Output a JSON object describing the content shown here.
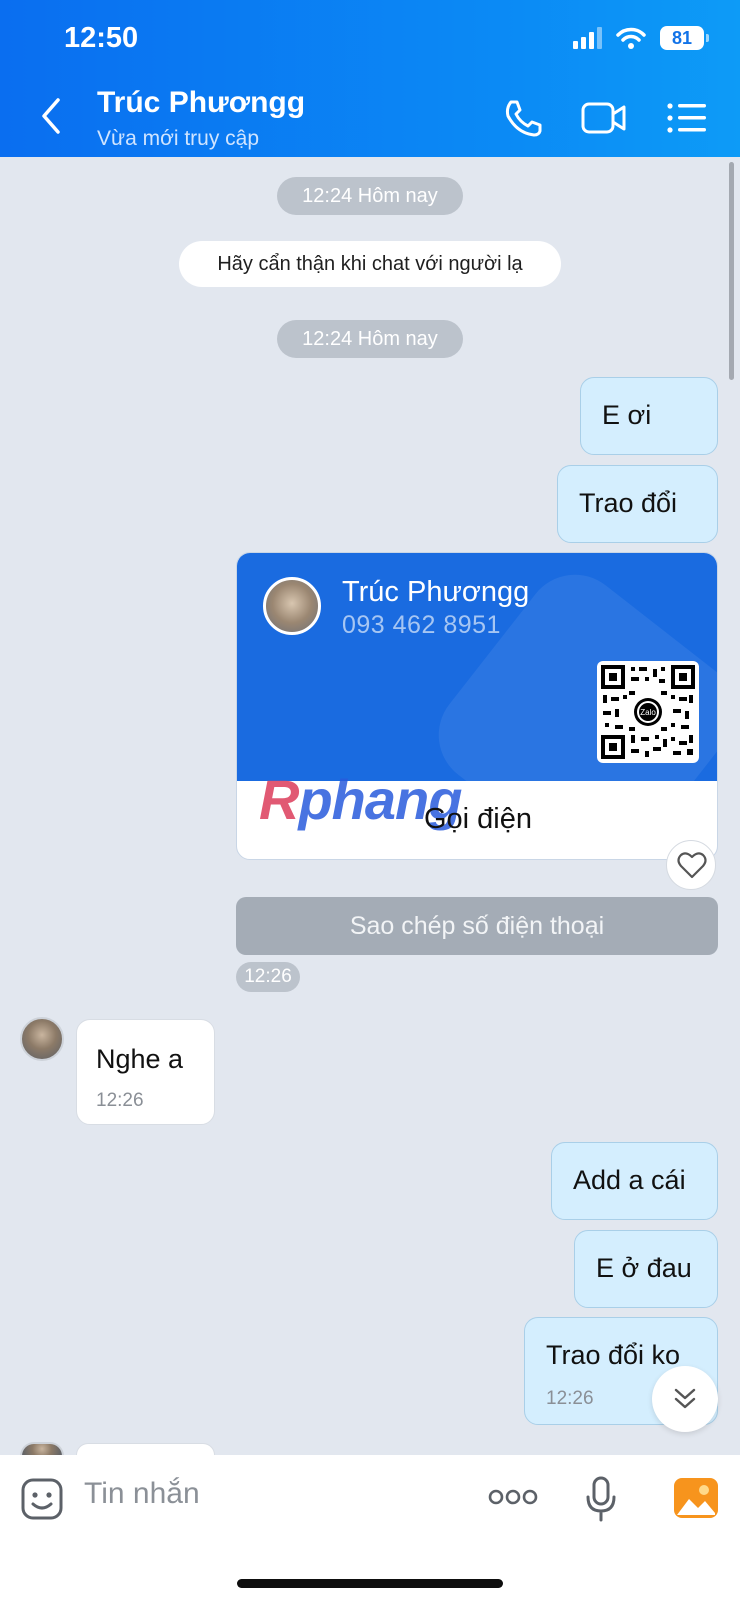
{
  "status_bar": {
    "time": "12:50",
    "battery": "81"
  },
  "header": {
    "name": "Trúc Phươngg",
    "status": "Vừa mới truy cập"
  },
  "chat": {
    "timestamp_1": "12:24 Hôm nay",
    "notice": "Hãy cẩn thận khi chat với người lạ",
    "timestamp_2": "12:24 Hôm nay",
    "out_1": "E ơi",
    "out_2": "Trao đổi",
    "card": {
      "name": "Trúc Phươngg",
      "phone": "093 462 8951",
      "call_label": "Gọi điện",
      "qr_brand": "Zalo"
    },
    "copy_label": "Sao chép số điện thoại",
    "card_time": "12:26",
    "in_1": {
      "text": "Nghe a",
      "time": "12:26"
    },
    "out_3": "Add a cái",
    "out_4": "E ở đau",
    "out_5": {
      "text": "Trao đổi ko",
      "time": "12:26"
    }
  },
  "watermark": {
    "part1": "R",
    "part2": "phang"
  },
  "input": {
    "placeholder": "Tin nhắn"
  },
  "colors": {
    "header": "#0a6ef0",
    "bubble_out": "#d4eefe",
    "card": "#1a6be0"
  }
}
